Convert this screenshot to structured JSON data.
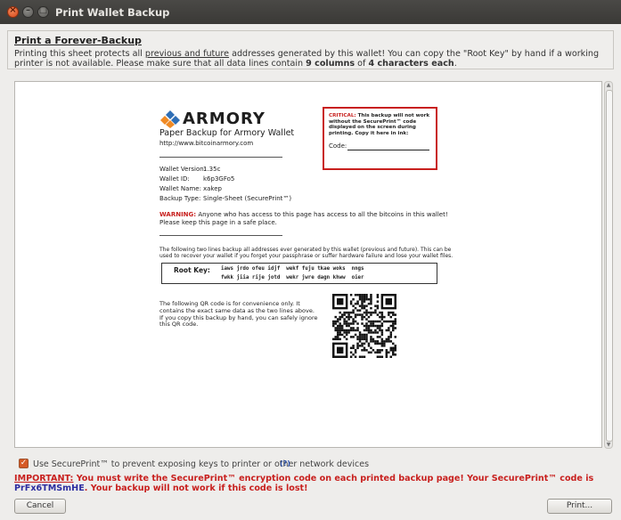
{
  "window": {
    "title": "Print Wallet Backup"
  },
  "info": {
    "heading": "Print a Forever-Backup",
    "text_1": "Printing this sheet protects all ",
    "text_link": "previous and future",
    "text_2": " addresses generated by this wallet! You can copy the \"Root Key\" by hand if a working printer is not available. Please make sure that all data lines contain ",
    "bold_1": "9 columns",
    "text_3": " of ",
    "bold_2": "4 characters each",
    "text_4": "."
  },
  "paper": {
    "logo_text": "ARMORY",
    "title": "Paper Backup for Armory Wallet",
    "url": "http://www.bitcoinarmory.com",
    "critical_label": "CRITICAL:",
    "critical_text": " This backup will not work without the SecurePrint™ code displayed on the screen during printing. Copy it here in ink:",
    "code_label": "Code:",
    "fields": [
      {
        "key": "Wallet Version:",
        "value": "1.35c"
      },
      {
        "key": "Wallet ID:",
        "value": "k6p3GFo5"
      },
      {
        "key": "Wallet Name:",
        "value": "xakep"
      },
      {
        "key": "Backup Type:",
        "value": "Single-Sheet (SecurePrint™)"
      }
    ],
    "warning_label": "WARNING:",
    "warning_text": " Anyone who has access to this page has access to all the bitcoins in this wallet! Please keep this page in a safe place.",
    "description": "The following two lines backup all addresses ever generated by this wallet (previous and future). This can be used to recover your wallet if you forget your passphrase or suffer hardware failure and lose your wallet files.",
    "root_key_label": "Root Key:",
    "root_key_line_1": "iaws jrdo ofeu idjf  wekf fuju tkae woks  nngs",
    "root_key_line_2": "fwkk jiia rije jotd  wekr jwre dagn khww  oier",
    "qr_text": "The following QR code is for convenience only. It contains the exact same data as the two lines above. If you copy this backup by hand, you can safely ignore this QR code."
  },
  "secureprint": {
    "checked": true,
    "label": "Use SecurePrint™ to prevent exposing keys to printer or other network devices",
    "help": "(?)"
  },
  "important": {
    "label": "IMPORTANT:",
    "text_1": " You must write the SecurePrint™ encryption code on each printed backup page! Your SecurePrint™ code is ",
    "code": "PrFx6TMSmHE",
    "text_2": ". Your backup will not work if this code is lost!"
  },
  "buttons": {
    "cancel": "Cancel",
    "print": "Print..."
  },
  "colors": {
    "accent": "#d65a26",
    "critical_red": "#c8201e",
    "code_blue": "#2c2ca0"
  },
  "icons": [
    "close-icon",
    "minimize-icon",
    "maximize-icon",
    "armory-logo-icon",
    "qr-code",
    "checkmark-icon"
  ]
}
